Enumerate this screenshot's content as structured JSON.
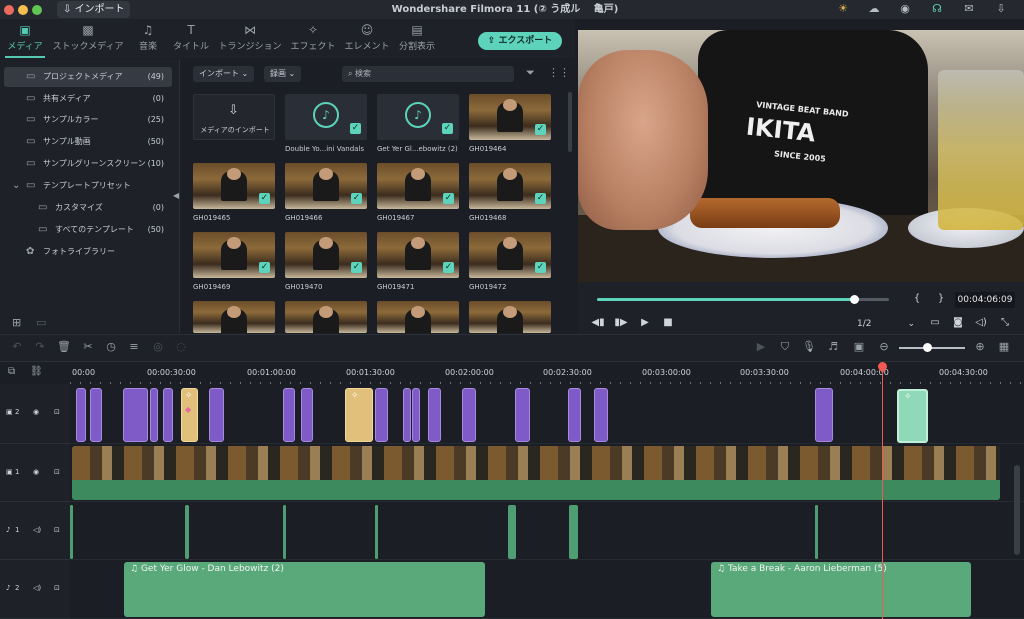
{
  "titlebar": {
    "import_label": "インポート",
    "app_title": "Wondershare Filmora 11 (② う成ル　 亀戸)",
    "icons": [
      "bulb-icon",
      "cloud-icon",
      "account-icon",
      "headset-icon",
      "mail-icon",
      "download-icon"
    ]
  },
  "tabs": [
    {
      "label": "メディア",
      "icon": "▣",
      "active": true
    },
    {
      "label": "ストックメディア",
      "icon": "▩"
    },
    {
      "label": "音楽",
      "icon": "♫"
    },
    {
      "label": "タイトル",
      "icon": "T"
    },
    {
      "label": "トランジション",
      "icon": "⋈"
    },
    {
      "label": "エフェクト",
      "icon": "✧"
    },
    {
      "label": "エレメント",
      "icon": "☺"
    },
    {
      "label": "分割表示",
      "icon": "▤"
    }
  ],
  "export_label": "エクスポート",
  "sidebar": {
    "items": [
      {
        "label": "プロジェクトメディア",
        "count": "(49)",
        "indent": 0,
        "selected": true
      },
      {
        "label": "共有メディア",
        "count": "(0)",
        "indent": 0
      },
      {
        "label": "サンプルカラー",
        "count": "(25)",
        "indent": 0
      },
      {
        "label": "サンプル動画",
        "count": "(50)",
        "indent": 0
      },
      {
        "label": "サンプルグリーンスクリーン",
        "count": "(10)",
        "indent": 0
      },
      {
        "label": "テンプレートプリセット",
        "count": "",
        "indent": 0
      },
      {
        "label": "カスタマイズ",
        "count": "(0)",
        "indent": 1
      },
      {
        "label": "すべてのテンプレート",
        "count": "(50)",
        "indent": 1
      },
      {
        "label": "フォトライブラリー",
        "count": "",
        "indent": 0
      }
    ]
  },
  "media": {
    "import_dropdown": "インポート",
    "record_dropdown": "録画",
    "search_placeholder": "検索",
    "import_tile": "メディアのインポート",
    "items": [
      {
        "label": "Double Yo...ini Vandals",
        "kind": "audio"
      },
      {
        "label": "Get Yer Gl...ebowitz (2)",
        "kind": "audio"
      },
      {
        "label": "GH019464",
        "kind": "video"
      },
      {
        "label": "GH019465",
        "kind": "video"
      },
      {
        "label": "GH019466",
        "kind": "video"
      },
      {
        "label": "GH019467",
        "kind": "video"
      },
      {
        "label": "GH019468",
        "kind": "video"
      },
      {
        "label": "GH019469",
        "kind": "video"
      },
      {
        "label": "GH019470",
        "kind": "video"
      },
      {
        "label": "GH019471",
        "kind": "video"
      },
      {
        "label": "GH019472",
        "kind": "video"
      }
    ]
  },
  "preview": {
    "shirt_line1": "VINTAGE BEAT BAND",
    "shirt_line2": "IKITA",
    "shirt_line3": "SINCE 2005",
    "timecode": "00:04:06:09",
    "quality": "1/2",
    "progress_fraction": 0.88
  },
  "timeline": {
    "ruler": [
      "00:00",
      "00:00:30:00",
      "00:01:00:00",
      "00:01:30:00",
      "00:02:00:00",
      "00:02:30:00",
      "00:03:00:00",
      "00:03:30:00",
      "00:04:00:00",
      "00:04:30:00"
    ],
    "tracks": [
      {
        "id": "2",
        "type": "video"
      },
      {
        "id": "1",
        "type": "video"
      },
      {
        "id": "1",
        "type": "audio"
      },
      {
        "id": "2",
        "type": "audio"
      }
    ],
    "audio_clips": [
      {
        "label": "Get Yer Glow - Dan Lebowitz (2)"
      },
      {
        "label": "Take a Break - Aaron Lieberman (5)"
      }
    ],
    "zoom_fraction": 0.42
  }
}
